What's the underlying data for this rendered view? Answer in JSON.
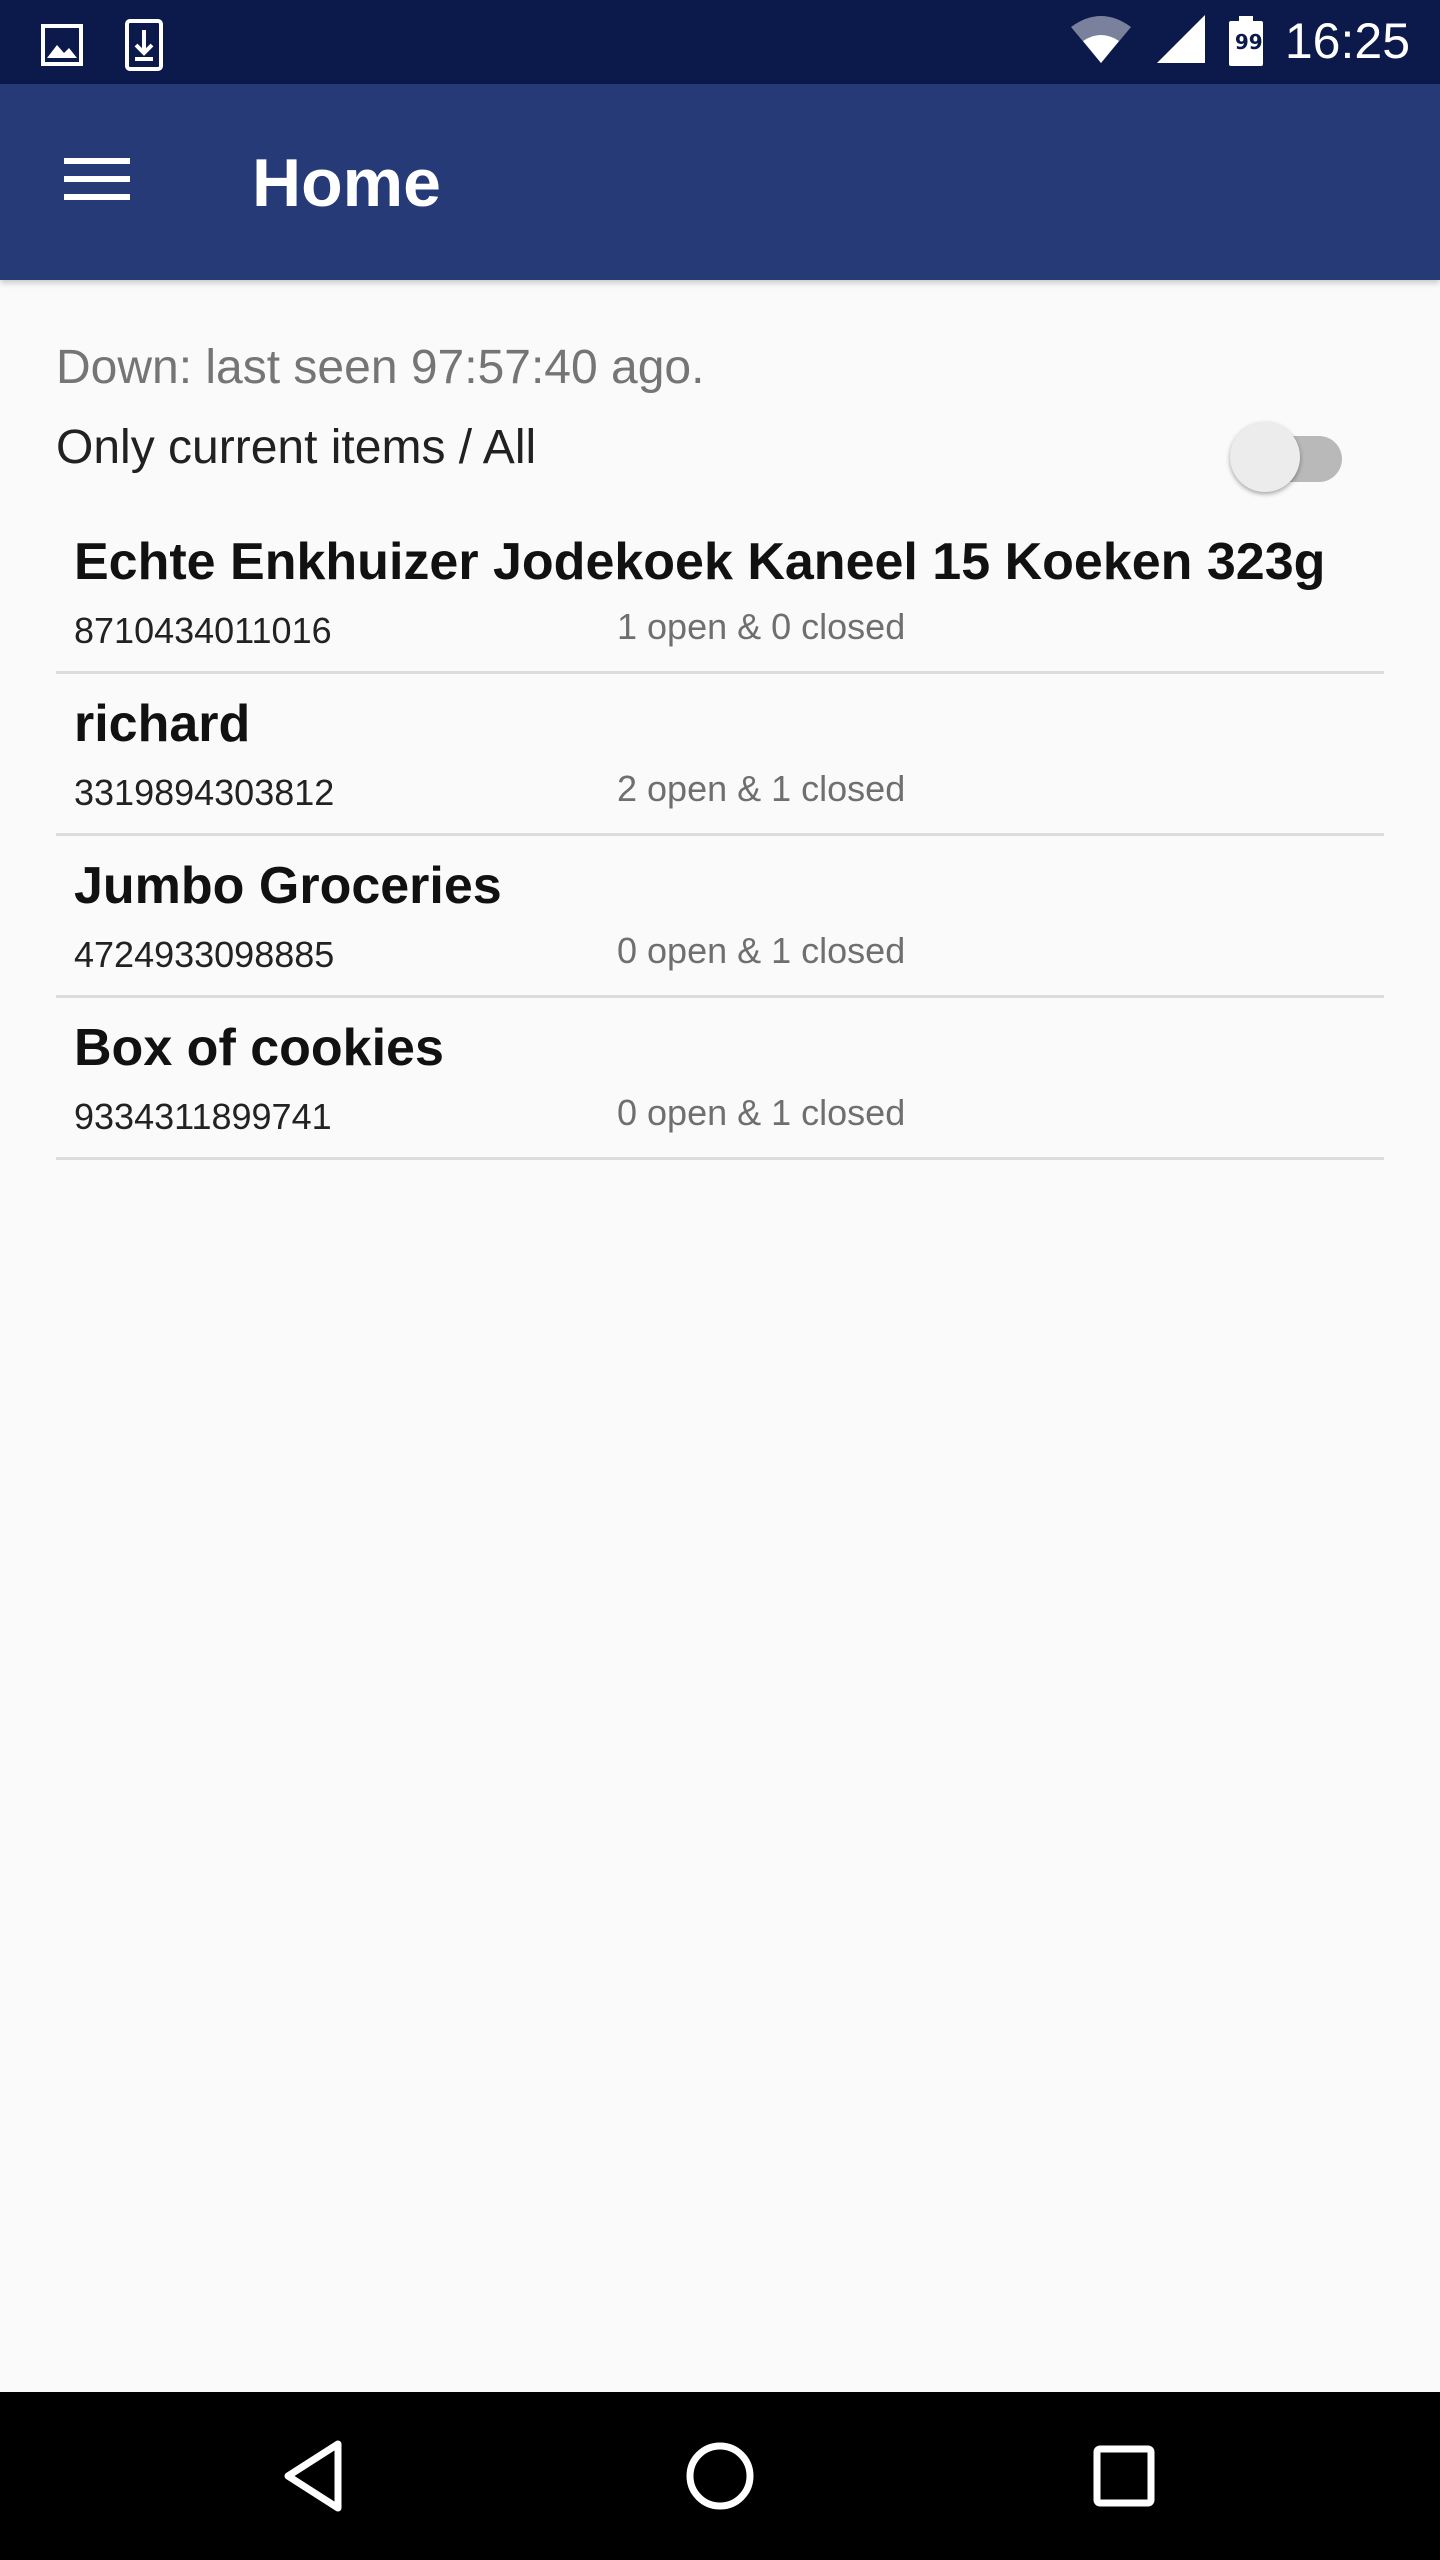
{
  "status_bar": {
    "time": "16:25",
    "battery_level": "99",
    "icons": [
      "image-notification-icon",
      "download-notification-icon",
      "wifi-icon",
      "cell-signal-icon",
      "battery-icon"
    ]
  },
  "app_bar": {
    "title": "Home",
    "menu_icon": "hamburger-menu-icon",
    "color": "#273a78"
  },
  "status": {
    "last_seen": "Down: last seen 97:57:40 ago."
  },
  "filter": {
    "label": "Only current items / All",
    "toggle_on": false
  },
  "items": [
    {
      "name": "Echte Enkhuizer Jodekoek Kaneel 15 Koeken 323g",
      "barcode": "8710434011016",
      "status": "1 open & 0 closed"
    },
    {
      "name": "richard",
      "barcode": "3319894303812",
      "status": "2 open & 1 closed"
    },
    {
      "name": "Jumbo Groceries",
      "barcode": "4724933098885",
      "status": "0 open & 1 closed"
    },
    {
      "name": "Box of cookies",
      "barcode": "9334311899741",
      "status": "0 open & 1 closed"
    }
  ],
  "nav_bar": {
    "buttons": [
      "back-icon",
      "home-icon",
      "recents-icon"
    ]
  }
}
